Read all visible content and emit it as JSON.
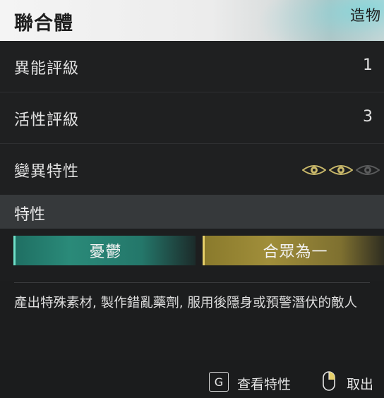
{
  "header": {
    "title": "聯合體",
    "tag": "造物"
  },
  "stats": [
    {
      "label": "異能評級",
      "value": "1"
    },
    {
      "label": "活性評級",
      "value": "3"
    },
    {
      "label": "變異特性",
      "eyes": [
        "eye-icon-gold",
        "eye-icon-gold",
        "eye-icon-gray"
      ]
    }
  ],
  "traits_section": {
    "label": "特性",
    "traits": [
      {
        "name": "憂鬱",
        "color": "#2a8a79"
      },
      {
        "name": "合眾為一",
        "color": "#a08e3a"
      }
    ]
  },
  "description": "產出特殊素材, 製作錯亂藥劑, 服用後隱身或預警潛伏的敵人",
  "footer": {
    "key": "G",
    "view_traits": "查看特性",
    "cancel": "取出"
  },
  "colors": {
    "gold": "#c9b86a",
    "teal": "#2a8a79",
    "header_bg": "#f0f0f0"
  }
}
